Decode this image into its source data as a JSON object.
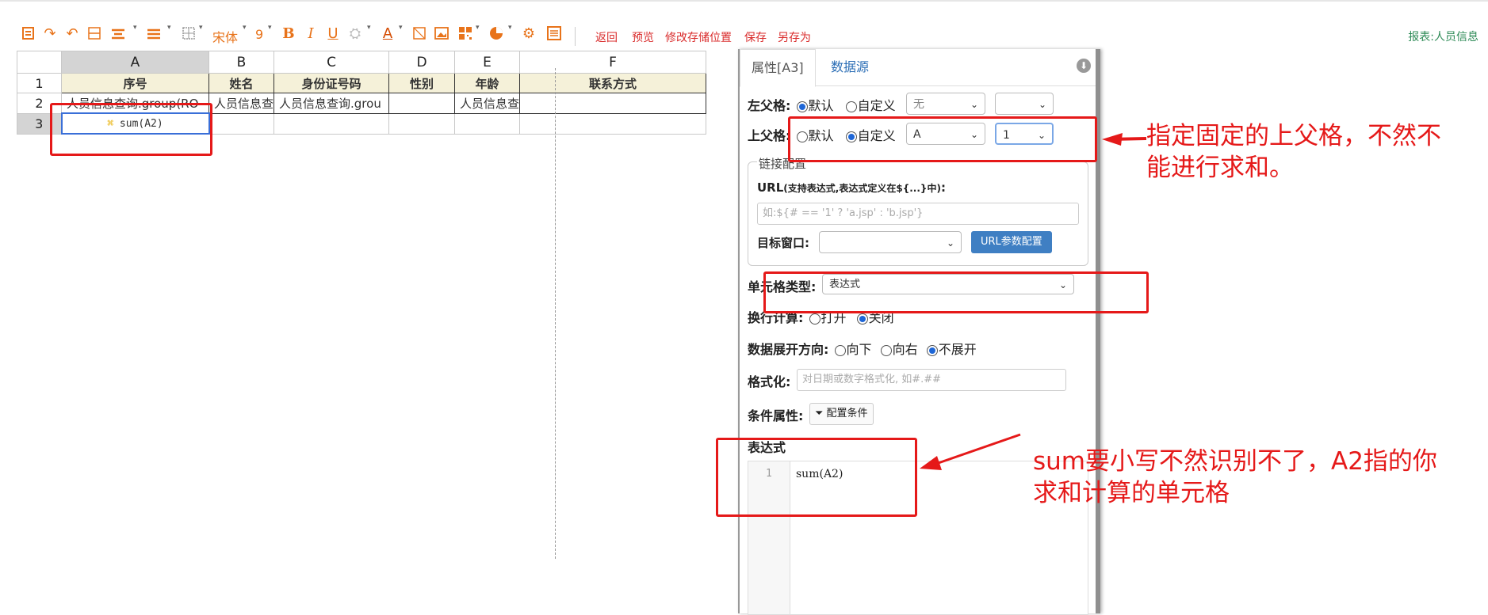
{
  "toolbar": {
    "font_name": "宋体",
    "font_size": "9",
    "actions": [
      "返回",
      "预览",
      "修改存储位置",
      "保存",
      "另存为"
    ],
    "report_name": "报表:人员信息",
    "icons": [
      "export-icon",
      "redo-icon",
      "undo-icon",
      "merge-icon",
      "align-center-icon",
      "align-left-icon",
      "border-icon",
      "bold-icon",
      "italic-icon",
      "underline-icon",
      "fill-color-icon",
      "font-color-icon",
      "image-icon",
      "picture-icon",
      "qrcode-icon",
      "chart-icon",
      "settings-icon",
      "list-icon"
    ]
  },
  "grid": {
    "columns": [
      "A",
      "B",
      "C",
      "D",
      "E",
      "F"
    ],
    "rows": [
      "1",
      "2",
      "3"
    ],
    "header_row": [
      "序号",
      "姓名",
      "身份证号码",
      "性别",
      "年龄",
      "联系方式"
    ],
    "data_row": [
      "人员信息查询.group(RO",
      "人员信息查",
      "人员信息查询.grou",
      "",
      "人员信息查",
      ""
    ],
    "formula_cell": "sum(A2)"
  },
  "panel": {
    "tabs": [
      "属性[A3]",
      "数据源"
    ],
    "left_parent": {
      "label": "左父格:",
      "opt_default": "默认",
      "opt_custom": "自定义",
      "selected": "default",
      "value1": "无",
      "value2": ""
    },
    "top_parent": {
      "label": "上父格:",
      "opt_default": "默认",
      "opt_custom": "自定义",
      "selected": "custom",
      "value1": "A",
      "value2": "1"
    },
    "link_legend": "链接配置",
    "url_label": "URL",
    "url_hint": "(支持表达式,表达式定义在${...}中)",
    "url_suffix": ":",
    "url_placeholder": "如:${# == '1' ? 'a.jsp' : 'b.jsp'}",
    "target_label": "目标窗口:",
    "target_value": "",
    "url_param_btn": "URL参数配置",
    "cell_type_label": "单元格类型:",
    "cell_type_value": "表达式",
    "wrap_label": "换行计算:",
    "wrap_on": "打开",
    "wrap_off": "关闭",
    "expand_label": "数据展开方向:",
    "expand_down": "向下",
    "expand_right": "向右",
    "expand_none": "不展开",
    "format_label": "格式化:",
    "format_placeholder": "对日期或数字格式化, 如#.##",
    "cond_label": "条件属性:",
    "cond_btn": "配置条件",
    "expr_label": "表达式",
    "expr_line": "1",
    "expr_code": "sum(A2)"
  },
  "annotations": {
    "note1_line1": "指定固定的上父格，不然不",
    "note1_line2": "能进行求和。",
    "note2_line1": "sum要小写不然识别不了，A2指的你",
    "note2_line2": "求和计算的单元格"
  },
  "colors": {
    "accent": "#e8731a",
    "annotation": "#e51919",
    "link": "#2a6db5",
    "button": "#3f7fc3"
  }
}
